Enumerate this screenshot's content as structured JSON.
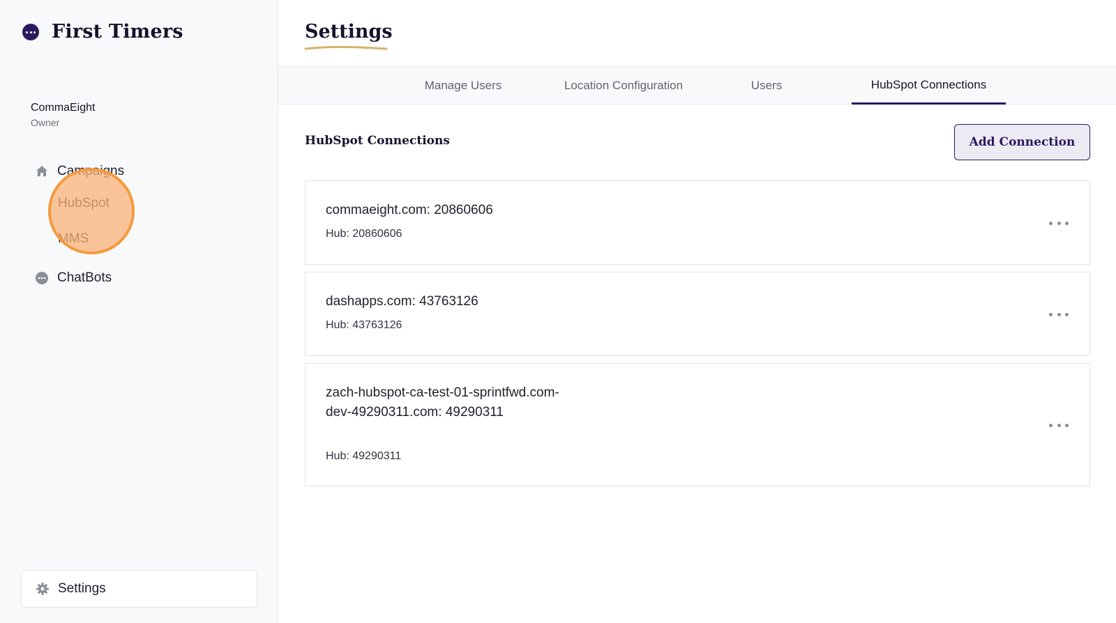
{
  "brand": {
    "name": "First Timers"
  },
  "account": {
    "name": "CommaEight",
    "role": "Owner"
  },
  "nav": {
    "campaigns": "Campaigns",
    "hubspot": "HubSpot",
    "mms": "MMS",
    "chatbots": "ChatBots",
    "settings": "Settings"
  },
  "page": {
    "title": "Settings"
  },
  "tabs": [
    {
      "label": "Manage Users"
    },
    {
      "label": "Location Configuration"
    },
    {
      "label": "Users"
    },
    {
      "label": "HubSpot Connections",
      "active": true
    }
  ],
  "section": {
    "title": "HubSpot Connections",
    "add_button": "Add Connection"
  },
  "connections": [
    {
      "name": "commaeight.com: 20860606",
      "hub": "Hub: 20860606"
    },
    {
      "name": "dashapps.com: 43763126",
      "hub": "Hub: 43763126"
    },
    {
      "name": "zach-hubspot-ca-test-01-sprintfwd.com-dev-49290311.com: 49290311",
      "hub": "Hub: 49290311"
    }
  ],
  "colors": {
    "accent": "#2a1a5e",
    "highlight": "#f59a3e",
    "title_underline": "#d4b36a"
  },
  "icons": {
    "brand": "chat-bubble-icon",
    "campaigns": "home-icon",
    "chatbots": "chat-bubble-icon",
    "settings": "gear-icon",
    "more": "more-horizontal-icon"
  }
}
